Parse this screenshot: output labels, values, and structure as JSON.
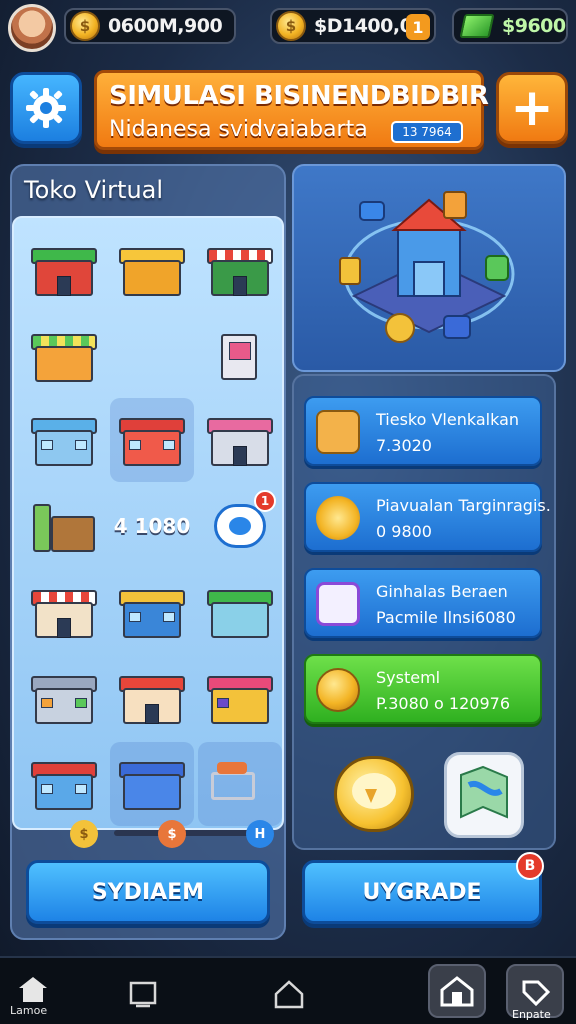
{
  "top_bar": {
    "resource_1": "0600M,900",
    "resource_1_icon": "coin-icon",
    "resource_2": "$D1400,0S",
    "resource_2_icon": "dollar-coin-icon",
    "resource_2_add": "1",
    "resource_3": "$9600",
    "resource_3_icon": "green-cash-icon"
  },
  "header": {
    "title": "SIMULASI BISINENDBIDBIR",
    "subtitle": "Nidanesa svidvaiabarta",
    "tag": "13 7964",
    "settings_icon": "gear-icon",
    "add_icon": "plus-icon"
  },
  "shop": {
    "title": "Toko Virtual",
    "value_label": "4 1080",
    "notification_badge": "1",
    "pager": {
      "dot_left": "$",
      "dot_mid": "$",
      "dot_right": "H"
    },
    "primary_button": "SYDIAEM"
  },
  "side": {
    "cards": [
      {
        "line1": "Tiesko Vlenkalkan",
        "line2": "7.3020",
        "icon": "box-icon"
      },
      {
        "line1": "Piavualan Targinragis.",
        "line2": "0 9800",
        "icon": "coins-icon"
      },
      {
        "line1": "Ginhalas Beraen",
        "line2": "Pacmile Ilnsi6080",
        "icon": "chat-icon"
      },
      {
        "line1": "Systeml",
        "line2": "P.3080 o 120976",
        "icon": "dollar-coin-icon"
      }
    ],
    "upgrade_button": "UYGRADE",
    "upgrade_badge": "B"
  },
  "bottom_nav": {
    "home_label": "Lamoe",
    "profile_label": "Enpate"
  },
  "colors": {
    "accent_orange": "#f07a12",
    "accent_blue": "#1e83e6",
    "accent_green": "#2fb020",
    "background": "#1c2c47"
  }
}
